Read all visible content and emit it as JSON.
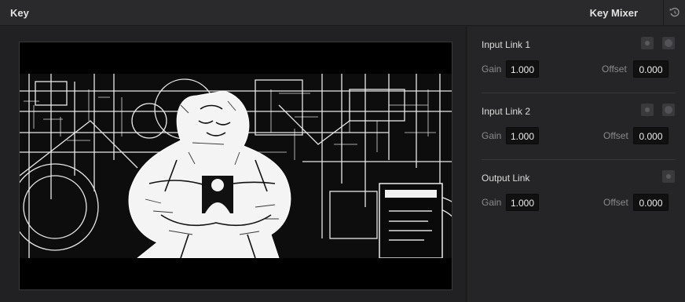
{
  "header": {
    "title": "Key",
    "mode_label": "Key Mixer",
    "reset_icon": "reset-icon"
  },
  "viewer": {
    "content": "key-matte-preview"
  },
  "controls": {
    "groups": [
      {
        "title": "Input Link 1",
        "gain_label": "Gain",
        "gain_value": "1.000",
        "offset_label": "Offset",
        "offset_value": "0.000"
      },
      {
        "title": "Input Link 2",
        "gain_label": "Gain",
        "gain_value": "1.000",
        "offset_label": "Offset",
        "offset_value": "0.000"
      },
      {
        "title": "Output Link",
        "gain_label": "Gain",
        "gain_value": "1.000",
        "offset_label": "Offset",
        "offset_value": "0.000"
      }
    ]
  }
}
